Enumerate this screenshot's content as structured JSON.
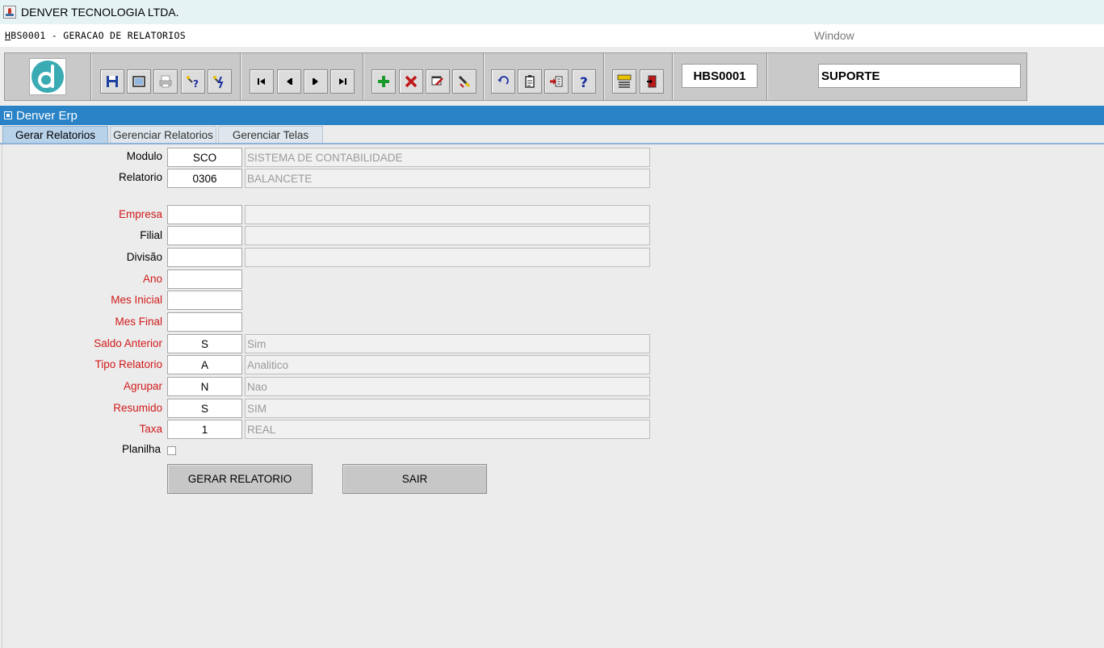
{
  "app": {
    "title": "DENVER TECNOLOGIA LTDA."
  },
  "menubar": {
    "form_title_first": "H",
    "form_title_rest": "BS0001 - GERACAO DE RELATORIOS",
    "window_menu": "Window"
  },
  "toolbar": {
    "form_code": "HBS0001",
    "user": "SUPORTE",
    "buttons": [
      "save-icon",
      "window-icon",
      "print-icon",
      "query-help-icon",
      "execute-query-icon",
      "first-record-icon",
      "previous-record-icon",
      "next-record-icon",
      "last-record-icon",
      "insert-record-icon",
      "delete-record-icon",
      "edit-record-icon",
      "clear-record-icon",
      "undo-icon",
      "clipboard-icon",
      "list-values-icon",
      "help-icon",
      "menu-icon",
      "exit-icon"
    ]
  },
  "window": {
    "title": "Denver Erp"
  },
  "tabs": [
    {
      "label": "Gerar Relatorios",
      "active": true
    },
    {
      "label": "Gerenciar Relatorios",
      "active": false
    },
    {
      "label": "Gerenciar Telas",
      "active": false
    }
  ],
  "form": {
    "modulo": {
      "label": "Modulo",
      "code": "SCO",
      "desc": "SISTEMA DE CONTABILIDADE"
    },
    "relatorio": {
      "label": "Relatorio",
      "code": "0306",
      "desc": "BALANCETE"
    },
    "empresa": {
      "label": "Empresa",
      "code": "",
      "desc": ""
    },
    "filial": {
      "label": "Filial",
      "code": "",
      "desc": ""
    },
    "divisao": {
      "label": "Divisão",
      "code": "",
      "desc": ""
    },
    "ano": {
      "label": "Ano",
      "code": ""
    },
    "mes_inicial": {
      "label": "Mes Inicial",
      "code": ""
    },
    "mes_final": {
      "label": "Mes Final",
      "code": ""
    },
    "saldo_anterior": {
      "label": "Saldo Anterior",
      "code": "S",
      "desc": "Sim"
    },
    "tipo_relatorio": {
      "label": "Tipo Relatorio",
      "code": "A",
      "desc": "Analitico"
    },
    "agrupar": {
      "label": "Agrupar",
      "code": "N",
      "desc": "Nao"
    },
    "resumido": {
      "label": "Resumido",
      "code": "S",
      "desc": "SIM"
    },
    "taxa": {
      "label": "Taxa",
      "code": "1",
      "desc": "REAL"
    },
    "planilha": {
      "label": "Planilha",
      "checked": false
    },
    "gerar_label": "GERAR RELATORIO",
    "sair_label": "SAIR"
  },
  "colors": {
    "required_label": "#d11a1a",
    "header_bg": "#2a83c6",
    "active_tab": "#b8d2ea"
  }
}
